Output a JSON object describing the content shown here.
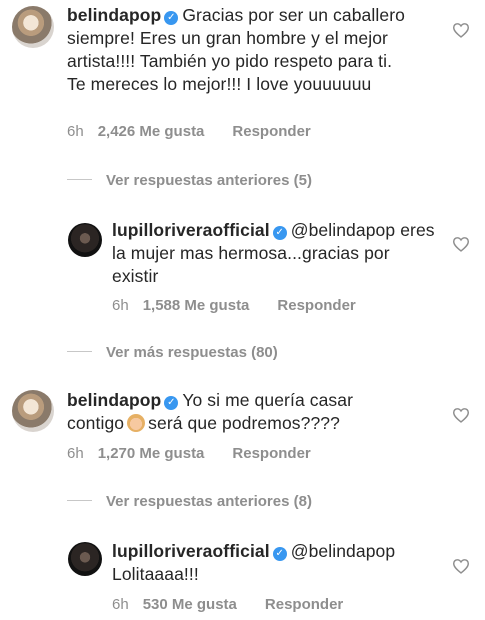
{
  "comments": [
    {
      "username": "belindapop",
      "mention": "",
      "text": "Gracias por ser un caballero siempre! Eres un gran hombre y el mejor artista!!!! También yo pido respeto para ti. Te mereces lo mejor!!! I love youuuuuu",
      "time": "6h",
      "likes": "2,426 Me gusta",
      "reply": "Responder"
    },
    {
      "username": "lupilloriveraofficial",
      "mention": "@belindapop",
      "text": "eres la mujer mas hermosa...gracias por existir",
      "time": "6h",
      "likes": "1,588 Me gusta",
      "reply": "Responder"
    },
    {
      "username": "belindapop",
      "mention": "",
      "text_before_emoji": "Yo si me quería casar contigo",
      "text_after_emoji": "será que podremos????",
      "emoji": "person-gesturing-emoji",
      "time": "6h",
      "likes": "1,270 Me gusta",
      "reply": "Responder"
    },
    {
      "username": "lupilloriveraofficial",
      "mention": "@belindapop",
      "text": "Lolitaaaa!!!",
      "time": "6h",
      "likes": "530 Me gusta",
      "reply": "Responder"
    }
  ],
  "toggles": [
    "Ver respuestas anteriores (5)",
    "Ver más respuestas (80)",
    "Ver respuestas anteriores (8)"
  ],
  "colors": {
    "text": "#262626",
    "muted": "#8e8e8e",
    "verified": "#3897f0"
  },
  "icons": {
    "verified": "verified-badge-icon",
    "like": "heart-outline-icon"
  }
}
